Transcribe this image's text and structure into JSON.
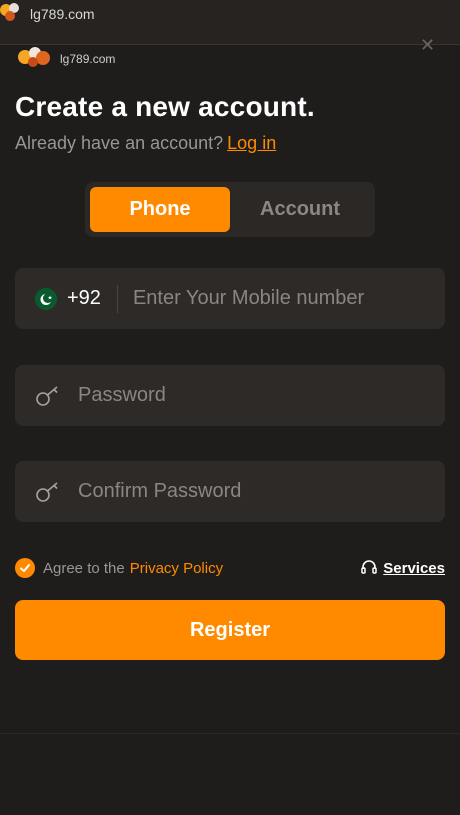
{
  "browser": {
    "domain": "lg789.com"
  },
  "sheet": {
    "brand_domain": "lg789.com",
    "title": "Create a new account.",
    "subtitle": "Already have an account?",
    "login_link": "Log in"
  },
  "tabs": [
    {
      "label": "Phone",
      "active": true
    },
    {
      "label": "Account",
      "active": false
    }
  ],
  "phone": {
    "country_code": "+92",
    "flag": "pakistan-flag-icon",
    "placeholder": "Enter Your Mobile number",
    "value": ""
  },
  "password": {
    "placeholder": "Password",
    "value": ""
  },
  "confirm_password": {
    "placeholder": "Confirm Password",
    "value": ""
  },
  "agree": {
    "checked": true,
    "text": "Agree to the",
    "policy_link": "Privacy Policy"
  },
  "services": {
    "label": "Services",
    "icon": "headset-icon"
  },
  "register_label": "Register",
  "colors": {
    "accent": "#ff8a00",
    "background": "#1f1d1c",
    "field_bg": "#2d2a28",
    "muted_text": "#9a9592"
  }
}
